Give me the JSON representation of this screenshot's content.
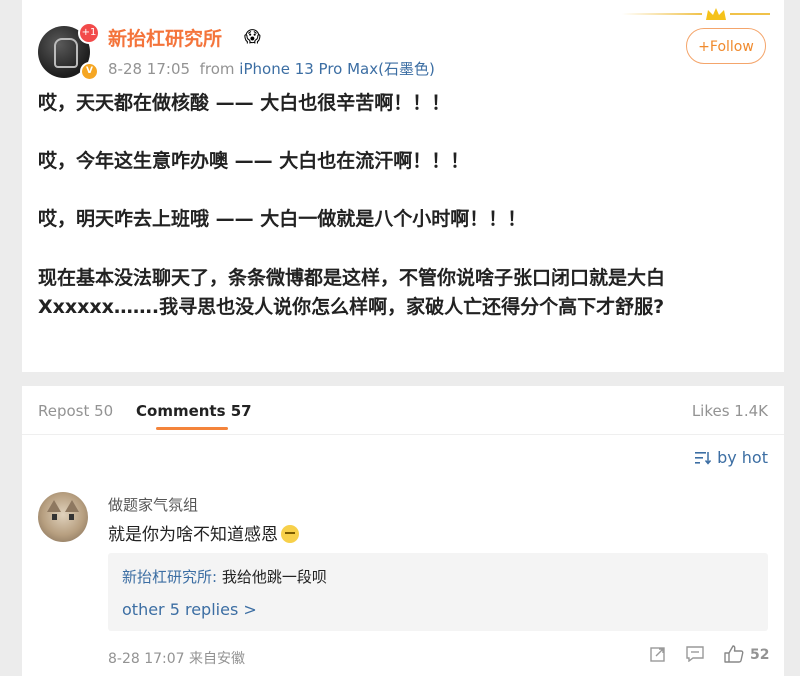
{
  "post": {
    "avatar_badge": "+1",
    "username": "新抬杠研究所",
    "user_emoji": "😱",
    "timestamp": "8-28 17:05",
    "from_label": "from",
    "device": "iPhone 13 Pro Max(石墨色)",
    "follow_label": "+Follow",
    "paragraphs": [
      "哎，天天都在做核酸 —— 大白也很辛苦啊！！！",
      "哎，今年这生意咋办噢 —— 大白也在流汗啊！！！",
      "哎，明天咋去上班哦 —— 大白一做就是八个小时啊！！！",
      "现在基本没法聊天了，条条微博都是这样，不管你说啥子张口闭口就是大白Xxxxxx…….我寻思也没人说你怎么样啊，家破人亡还得分个高下才舒服?"
    ]
  },
  "tabs": {
    "repost": "Repost 50",
    "comments": "Comments 57",
    "likes": "Likes 1.4K"
  },
  "sort": {
    "label": "by hot",
    "icon": "sort-icon"
  },
  "comment": {
    "username": "做题家气氛组",
    "text": "就是你为啥不知道感恩",
    "reply": {
      "user": "新抬杠研究所:",
      "text": " 我给他跳一段呗",
      "more": "other 5 replies >"
    },
    "timestamp": "8-28 17:07",
    "location": "来自安徽",
    "like_count": "52"
  },
  "colors": {
    "username": "#f4743b",
    "link_blue": "#3c6ea3",
    "accent": "#f4843b",
    "background": "#ececec"
  }
}
